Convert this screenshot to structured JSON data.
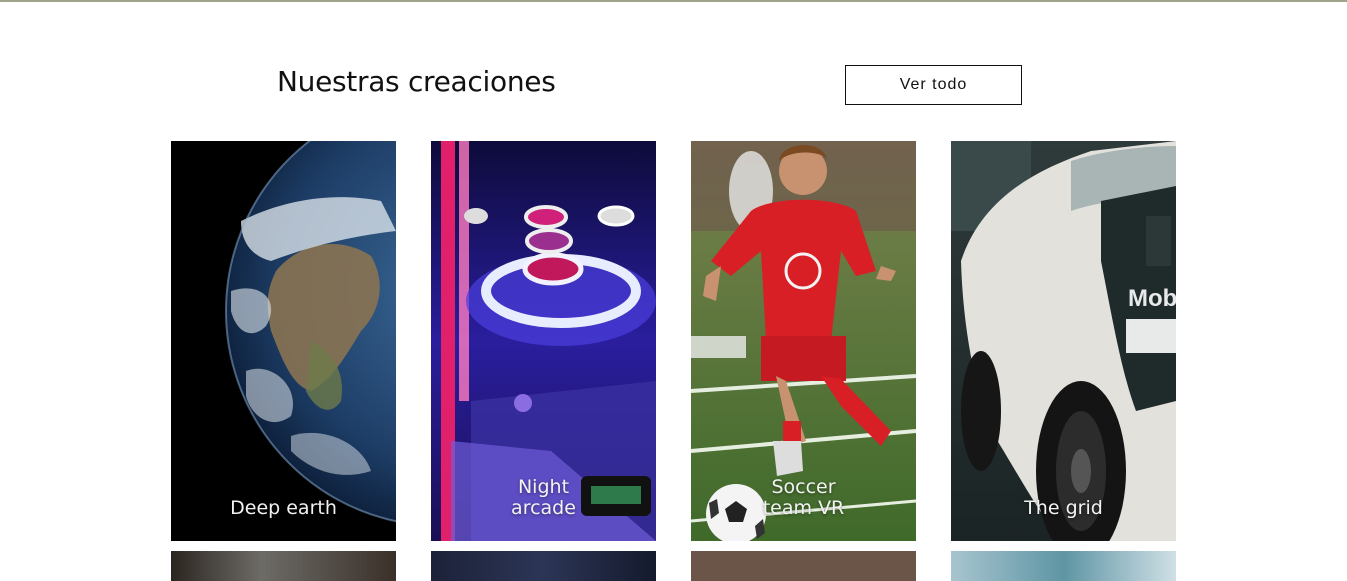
{
  "section": {
    "title": "Nuestras creaciones",
    "view_all_label": "Ver todo"
  },
  "cards": [
    {
      "label": "Deep earth"
    },
    {
      "label": "Night arcade"
    },
    {
      "label": "Soccer team VR"
    },
    {
      "label": "The grid"
    }
  ],
  "colors": {
    "top_rule": "#9ea38c",
    "text": "#111111",
    "card_label": "#f2f2f2"
  }
}
